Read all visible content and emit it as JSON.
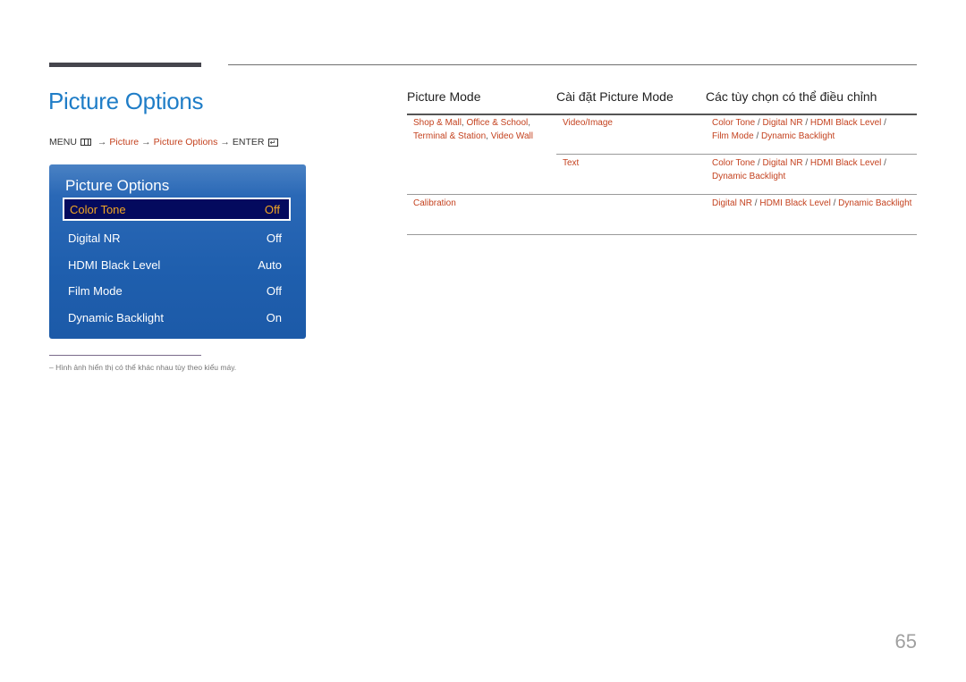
{
  "title": "Picture Options",
  "breadcrumb": {
    "menu": "MENU",
    "menu_icon": "menu-icon",
    "arrow": "→",
    "step1": "Picture",
    "step2": "Picture Options",
    "enter": "ENTER",
    "enter_icon": "enter-icon"
  },
  "osd": {
    "title": "Picture Options",
    "items": [
      {
        "label": "Color Tone",
        "value": "Off",
        "selected": true
      },
      {
        "label": "Digital NR",
        "value": "Off"
      },
      {
        "label": "HDMI Black Level",
        "value": "Auto"
      },
      {
        "label": "Film Mode",
        "value": "Off"
      },
      {
        "label": "Dynamic Backlight",
        "value": "On"
      }
    ]
  },
  "footnote": "–  Hình ảnh hiển thị có thể khác nhau tùy theo kiểu máy.",
  "table": {
    "headers": [
      "Picture Mode",
      "Cài đặt Picture Mode",
      "Các tùy chọn có thể điều chỉnh"
    ],
    "rows": [
      {
        "mode": "Shop & Mall, Office & School, Terminal & Station, Video Wall",
        "mode_parts": [
          "Shop & Mall",
          ", ",
          "Office & School",
          ",",
          "Terminal & Station",
          ", ",
          "Video Wall"
        ],
        "setting": "Video/Image",
        "options": [
          "Color Tone",
          "Digital NR",
          "HDMI Black Level",
          "Film Mode",
          "Dynamic Backlight"
        ]
      },
      {
        "mode": "",
        "setting": "Text",
        "options": [
          "Color Tone",
          "Digital NR",
          "HDMI Black Level",
          "Dynamic Backlight"
        ]
      },
      {
        "mode": "Calibration",
        "setting": "",
        "options": [
          "Digital NR",
          "HDMI Black Level",
          "Dynamic Backlight"
        ]
      }
    ],
    "separator": " / "
  },
  "page_number": "65"
}
